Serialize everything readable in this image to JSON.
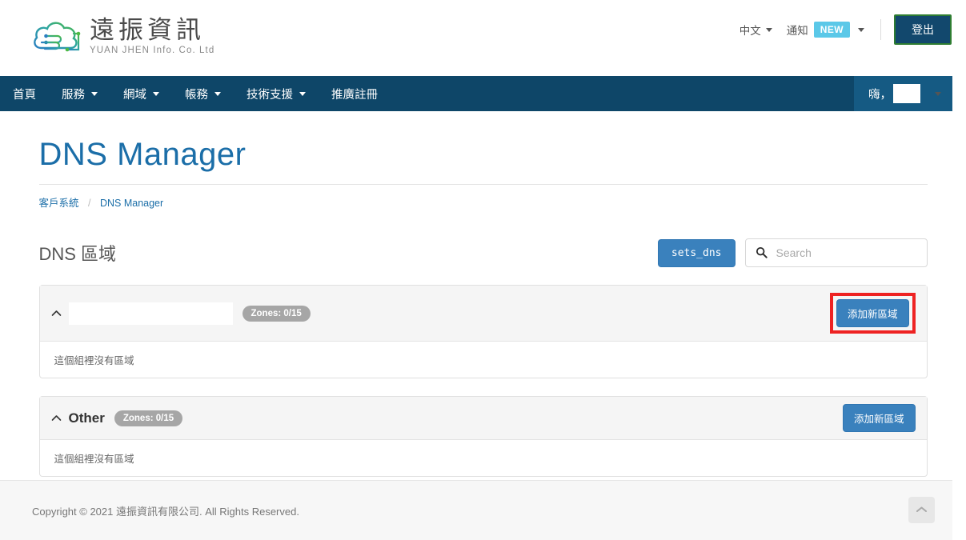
{
  "brand": {
    "name_cn": "遠振資訊",
    "name_en": "YUAN JHEN Info. Co. Ltd",
    "logo_icon": "cloud-circuit-icon"
  },
  "header": {
    "language_label": "中文",
    "notification_label": "通知",
    "notification_badge": "NEW",
    "logout_label": "登出",
    "accent_blue": "#0e4668",
    "logout_border_green": "#2e7d32",
    "badge_new_color": "#5bc8e8"
  },
  "nav": {
    "items": [
      {
        "label": "首頁",
        "has_caret": false
      },
      {
        "label": "服務",
        "has_caret": true
      },
      {
        "label": "網域",
        "has_caret": true
      },
      {
        "label": "帳務",
        "has_caret": true
      },
      {
        "label": "技術支援",
        "has_caret": true
      },
      {
        "label": "推廣註冊",
        "has_caret": false
      }
    ],
    "user_greeting": "嗨，",
    "user_name": ""
  },
  "page": {
    "title": "DNS Manager",
    "title_color": "#1b6ea8",
    "breadcrumb": {
      "root": "客戶系統",
      "separator": "/",
      "current": "DNS Manager"
    }
  },
  "section": {
    "title": "DNS 區域",
    "sets_dns_label": "sets_dns",
    "search_placeholder": "Search",
    "search_value": "",
    "search_icon": "search-icon"
  },
  "groups": [
    {
      "name": "",
      "name_redacted": true,
      "collapse_icon": "chevron-up-icon",
      "zones_badge": "Zones: 0/15",
      "empty_text": "這個組裡沒有區域",
      "add_zone_label": "添加新區域",
      "highlighted": true
    },
    {
      "name": "Other",
      "name_redacted": false,
      "collapse_icon": "chevron-up-icon",
      "zones_badge": "Zones: 0/15",
      "empty_text": "這個組裡沒有區域",
      "add_zone_label": "添加新區域",
      "highlighted": false
    }
  ],
  "footer": {
    "copyright": "Copyright © 2021 遠振資訊有限公司. All Rights Reserved.",
    "to_top_icon": "chevron-up-icon"
  },
  "annotation": {
    "highlight_color": "#ee2222"
  }
}
